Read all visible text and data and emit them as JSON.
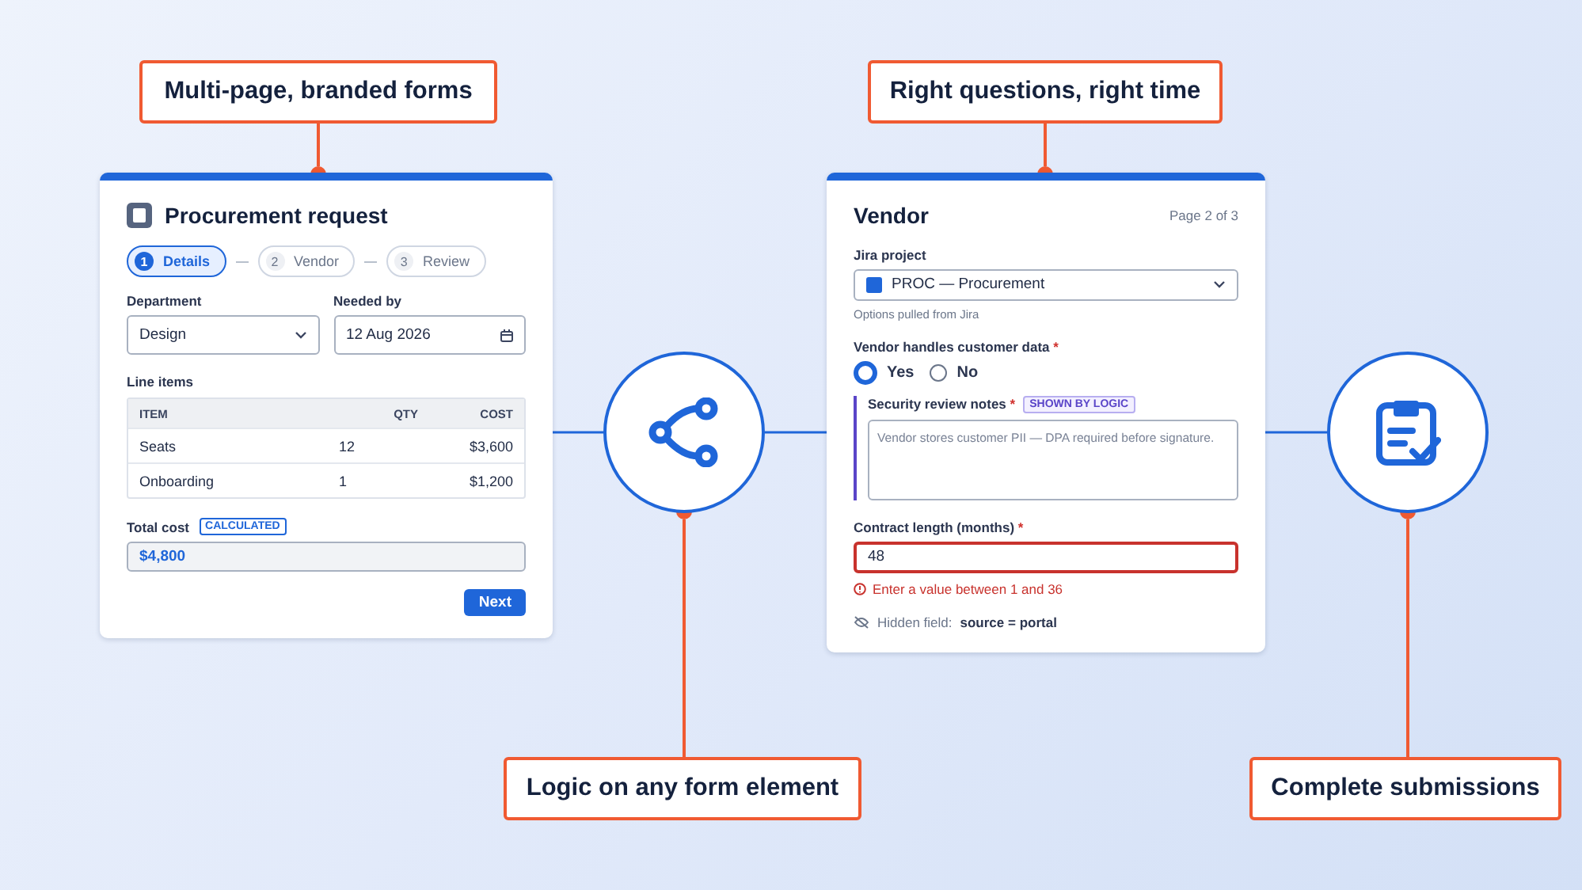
{
  "callouts": [
    {
      "text": "Multi-page, branded forms"
    },
    {
      "text": "Right questions, right time"
    },
    {
      "text": "Logic on any form element"
    },
    {
      "text": "Complete submissions"
    }
  ],
  "nodes": [
    {
      "kind": "branch"
    },
    {
      "kind": "checklist"
    }
  ],
  "details_card": {
    "title": "Procurement request",
    "steps": [
      {
        "number": "1",
        "label": "Details",
        "selected": true
      },
      {
        "number": "2",
        "label": "Vendor",
        "selected": false
      },
      {
        "number": "3",
        "label": "Review",
        "selected": false
      }
    ],
    "department": {
      "label": "Department",
      "value": "Design"
    },
    "needed_by": {
      "label": "Needed by",
      "value": "12 Aug 2026"
    },
    "line_items": {
      "label": "Line items",
      "columns": [
        "ITEM",
        "QTY",
        "COST"
      ],
      "rows": [
        [
          "Seats",
          "12",
          "$3,600"
        ],
        [
          "Onboarding",
          "1",
          "$1,200"
        ]
      ]
    },
    "total": {
      "label": "Total cost",
      "badge": "CALCULATED",
      "value": "$4,800"
    },
    "next_button": "Next"
  },
  "vendor_card": {
    "title": "Vendor",
    "page": "Page 2 of 3",
    "jira_project": {
      "label": "Jira project",
      "value": "PROC — Procurement",
      "help": "Options pulled from Jira"
    },
    "customer_data": {
      "label": "Vendor handles customer data",
      "required_mark": "*",
      "options": [
        {
          "label": "Yes",
          "selected": true
        },
        {
          "label": "No",
          "selected": false
        }
      ]
    },
    "security_notes": {
      "label": "Security review notes",
      "required_mark": "*",
      "badge": "SHOWN BY LOGIC",
      "placeholder": "Vendor stores customer PII — DPA required before signature."
    },
    "contract_length": {
      "label": "Contract length (months)",
      "required_mark": "*",
      "value": "48",
      "invalid": true,
      "error": "Enter a value between 1 and 36"
    },
    "hidden_field": {
      "label": "Hidden field:",
      "value": "source = portal"
    }
  }
}
